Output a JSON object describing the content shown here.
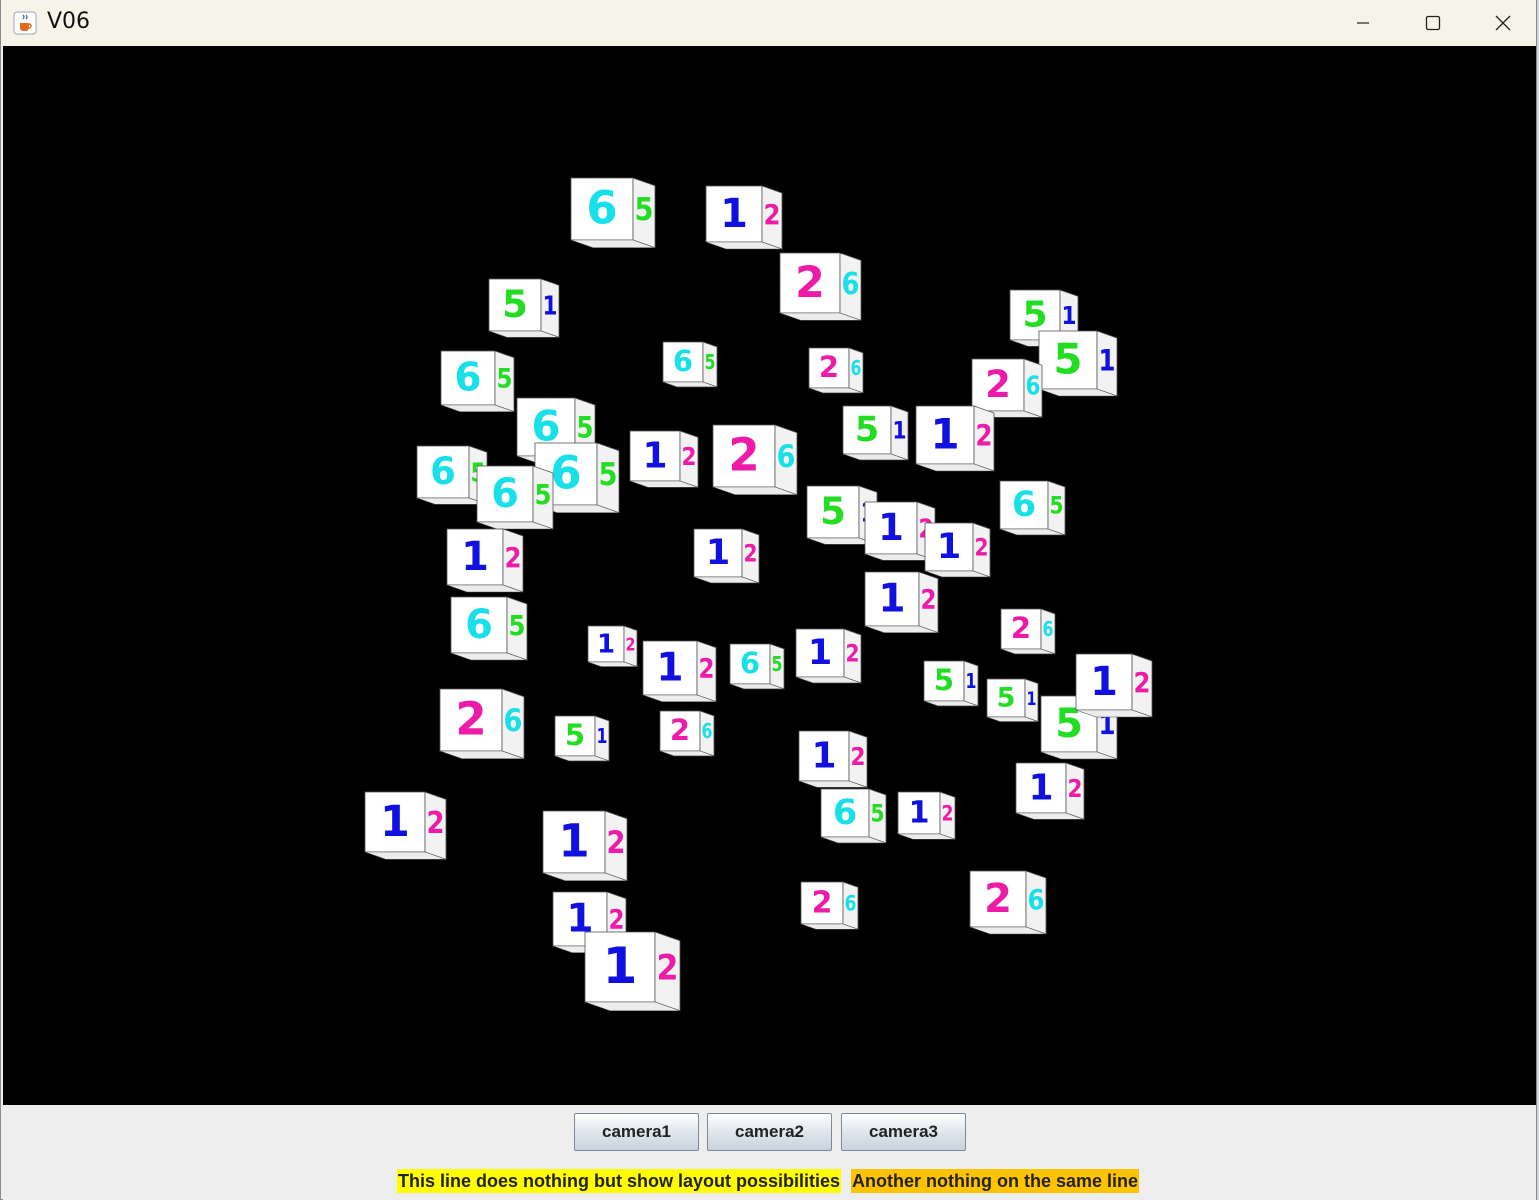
{
  "window": {
    "title": "V06",
    "app_icon": "java-cup-icon",
    "controls": [
      "minimize-icon",
      "maximize-icon",
      "close-icon"
    ]
  },
  "scene": {
    "background": "#000000",
    "cube_face_color": "#ffffff",
    "digit_colors": {
      "1": "#1010e0",
      "2": "#ee1aa8",
      "3": "#e81414",
      "4": "#f08a00",
      "5": "#22dd22",
      "6": "#18e0e8"
    },
    "cubes": [
      {
        "front": "6",
        "side": "5"
      },
      {
        "front": "1",
        "side": "2"
      },
      {
        "front": "2",
        "side": "6"
      },
      {
        "front": "5",
        "side": "1"
      },
      {
        "front": "6",
        "side": "5"
      },
      {
        "front": "6",
        "side": "5"
      },
      {
        "front": "2",
        "side": "6"
      },
      {
        "front": "5",
        "side": "1"
      },
      {
        "front": "5",
        "side": "1"
      },
      {
        "front": "2",
        "side": "6"
      },
      {
        "front": "6",
        "side": "5"
      },
      {
        "front": "5",
        "side": "1"
      },
      {
        "front": "1",
        "side": "2"
      },
      {
        "front": "2",
        "side": "6"
      },
      {
        "front": "6",
        "side": "5"
      },
      {
        "front": "6",
        "side": "5"
      },
      {
        "front": "1",
        "side": "2"
      },
      {
        "front": "6",
        "side": "5"
      },
      {
        "front": "5",
        "side": "1"
      },
      {
        "front": "1",
        "side": "2"
      },
      {
        "front": "1",
        "side": "2"
      },
      {
        "front": "1",
        "side": "2"
      },
      {
        "front": "1",
        "side": "2"
      },
      {
        "front": "6",
        "side": "5"
      },
      {
        "front": "1",
        "side": "2"
      },
      {
        "front": "5",
        "side": "1"
      },
      {
        "front": "2",
        "side": "6"
      },
      {
        "front": "1",
        "side": "2"
      },
      {
        "front": "6",
        "side": "5"
      },
      {
        "front": "1",
        "side": "2"
      },
      {
        "front": "2",
        "side": "6"
      },
      {
        "front": "5",
        "side": "1"
      },
      {
        "front": "2",
        "side": "6"
      },
      {
        "front": "1",
        "side": "2"
      },
      {
        "front": "5",
        "side": "1"
      },
      {
        "front": "5",
        "side": "1"
      },
      {
        "front": "1",
        "side": "2"
      },
      {
        "front": "1",
        "side": "2"
      },
      {
        "front": "6",
        "side": "5"
      },
      {
        "front": "1",
        "side": "2"
      },
      {
        "front": "1",
        "side": "2"
      },
      {
        "front": "6",
        "side": "5"
      },
      {
        "front": "2",
        "side": "6"
      },
      {
        "front": "1",
        "side": "2"
      },
      {
        "front": "1",
        "side": "2"
      },
      {
        "front": "2",
        "side": "6"
      },
      {
        "front": "1",
        "side": "2"
      },
      {
        "front": "1",
        "side": "2"
      }
    ]
  },
  "controls": {
    "buttons": [
      {
        "label": "camera1"
      },
      {
        "label": "camera2"
      },
      {
        "label": "camera3"
      }
    ],
    "note1": {
      "text": "This line does nothing but show layout possibilities",
      "bg": "#ffff00"
    },
    "note2": {
      "text": "Another nothing on the same line",
      "bg": "#ffc300"
    }
  }
}
